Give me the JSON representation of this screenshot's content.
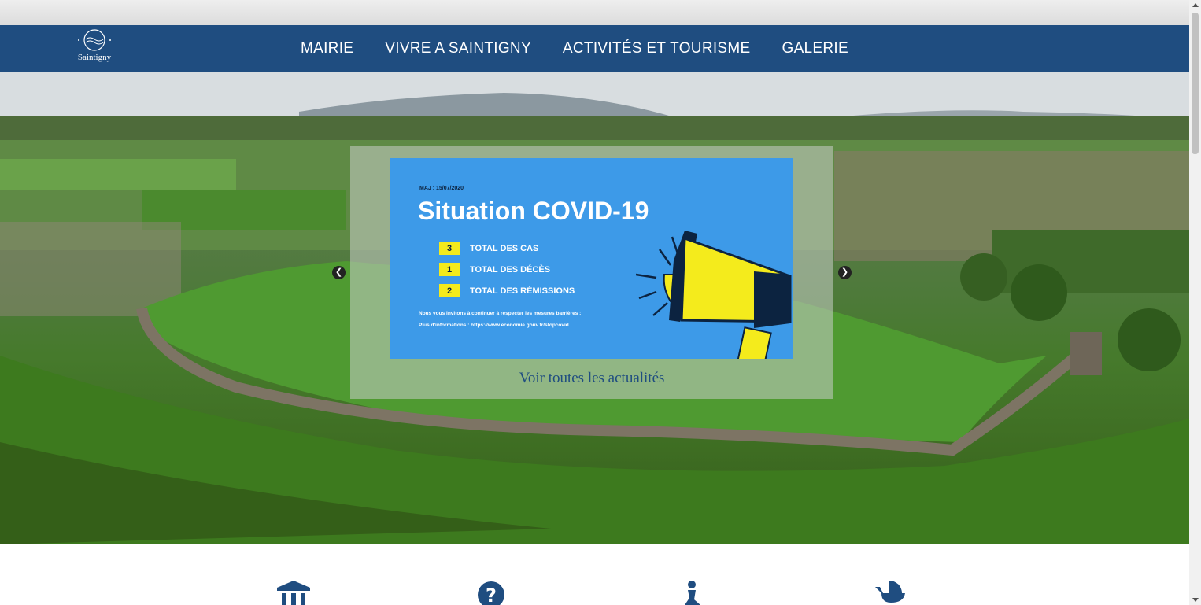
{
  "site": {
    "logo_text": "Saintigny",
    "brand_color": "#1f4d80"
  },
  "nav": {
    "items": [
      {
        "label": "MAIRIE"
      },
      {
        "label": "VIVRE A SAINTIGNY"
      },
      {
        "label": "ACTIVITÉS ET TOURISME"
      },
      {
        "label": "GALERIE"
      }
    ]
  },
  "slide": {
    "maj": "MAJ : 15/07/2020",
    "title": "Situation COVID-19",
    "stats": [
      {
        "value": "3",
        "label": "TOTAL DES CAS"
      },
      {
        "value": "1",
        "label": "TOTAL DES DÉCÈS"
      },
      {
        "value": "2",
        "label": "TOTAL DES RÉMISSIONS"
      }
    ],
    "notice_line1": "Nous vous invitons à continuer à respecter les mesures barrières :",
    "notice_line2": "Plus d'informations : https://www.economie.gouv.fr/stopcovid",
    "background_color": "#3d9ae8",
    "highlight_color": "#f4eb1c"
  },
  "carousel": {
    "prev_icon": "chevron-left-icon",
    "next_icon": "chevron-right-icon",
    "link_label": "Voir toutes les actualités"
  },
  "quick_links": {
    "icons": [
      "institution-icon",
      "question-icon",
      "person-icon",
      "baby-carriage-icon"
    ]
  }
}
